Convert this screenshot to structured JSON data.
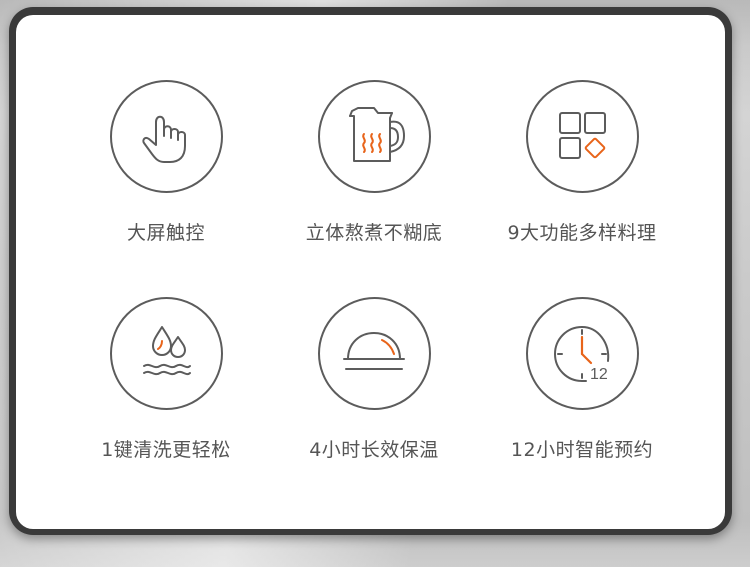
{
  "colors": {
    "outline": "#5c5c5c",
    "accent": "#e8641a",
    "label": "#555555",
    "frame": "#3a3a3a",
    "screen": "#ffffff"
  },
  "features": [
    {
      "label": "大屏触控",
      "icon": "touch-hand-icon"
    },
    {
      "label": "立体熬煮不糊底",
      "icon": "kettle-icon"
    },
    {
      "label": "9大功能多样料理",
      "icon": "function-grid-icon"
    },
    {
      "label": "1键清洗更轻松",
      "icon": "water-drops-icon"
    },
    {
      "label": "4小时长效保温",
      "icon": "food-dome-icon"
    },
    {
      "label": "12小时智能预约",
      "icon": "clock-icon",
      "clock_number": "12"
    }
  ]
}
